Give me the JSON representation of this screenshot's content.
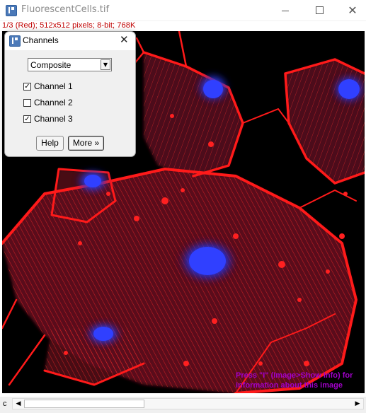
{
  "window": {
    "title": "FluorescentCells.tif",
    "minimize_glyph": "",
    "maximize_glyph": "",
    "close_glyph": "✕"
  },
  "info_line": "1/3 (Red); 512x512 pixels; 8-bit; 768K",
  "overlay": {
    "line1": "Press \"I\" (Image>Show Info) for",
    "line2": "information about this image"
  },
  "scrollbar": {
    "channel_letter": "c",
    "left_arrow": "◀",
    "right_arrow": "▶"
  },
  "dialog": {
    "title": "Channels",
    "close_glyph": "✕",
    "mode": {
      "value": "Composite",
      "arrow": "▼"
    },
    "channels": [
      {
        "label": "Channel 1",
        "checked": true,
        "mark": "✓"
      },
      {
        "label": "Channel 2",
        "checked": false,
        "mark": ""
      },
      {
        "label": "Channel 3",
        "checked": true,
        "mark": "✓"
      }
    ],
    "help_label": "Help",
    "more_label": "More »"
  },
  "colors": {
    "info_text": "#c00000",
    "overlay_text": "#a000c8",
    "actin_red": "#e8141e",
    "nuclei_blue": "#2a3cff",
    "background": "#000000"
  },
  "icons": {
    "app": "imagej-icon",
    "window_min": "minimize-icon",
    "window_max": "maximize-icon",
    "window_close": "close-icon"
  }
}
